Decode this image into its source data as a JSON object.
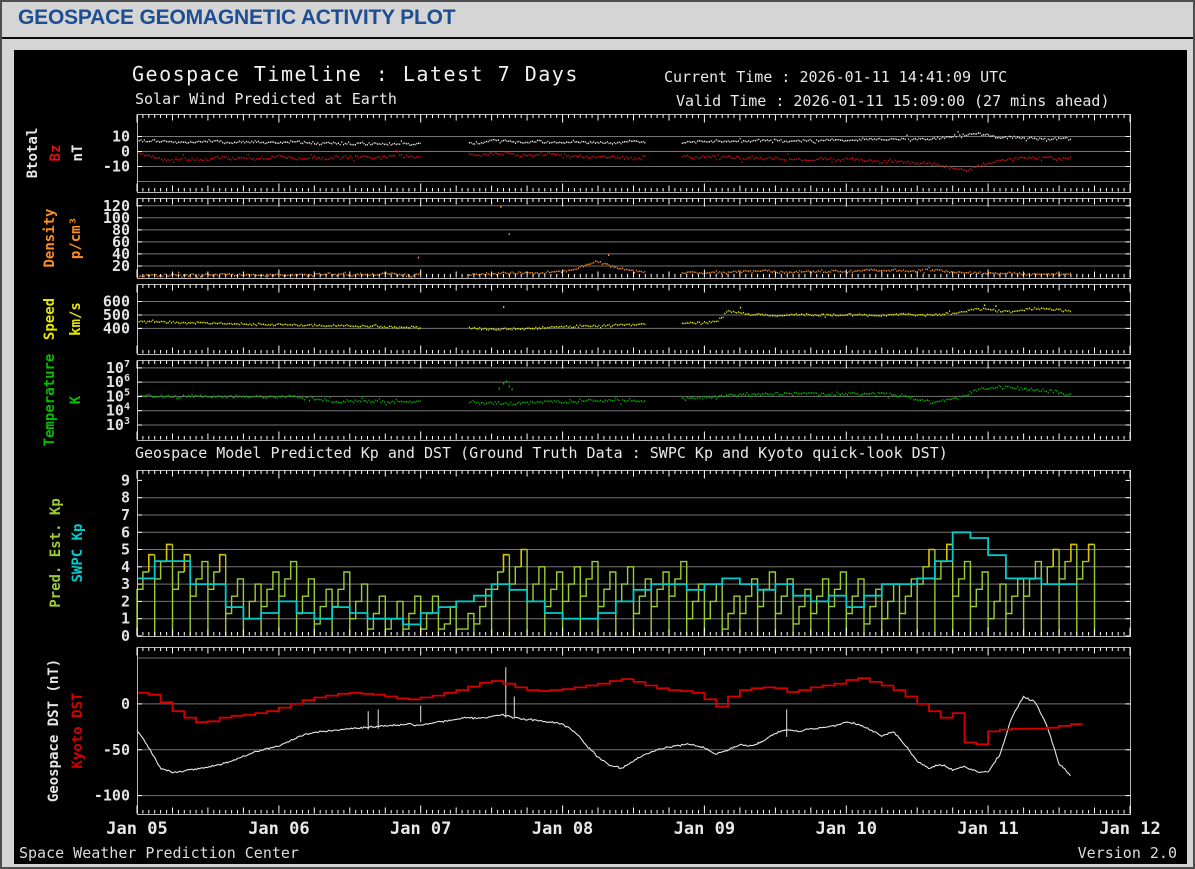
{
  "window": {
    "title": "GEOSPACE GEOMAGNETIC ACTIVITY PLOT",
    "footer_left": "Space Weather Prediction Center",
    "footer_right": "Version 2.0"
  },
  "header": {
    "title": "Geospace Timeline : Latest 7 Days",
    "subtitle": "Solar Wind Predicted at Earth",
    "current_time": "Current Time : 2026-01-11 14:41:09 UTC",
    "valid_time": "Valid Time : 2026-01-11 15:09:00 (27 mins ahead)",
    "kp_section_title": "Geospace Model Predicted Kp and DST (Ground Truth Data : SWPC Kp and Kyoto quick-look DST)"
  },
  "colors": {
    "page_bg": "#d5d5d5",
    "header_blue": "#1e4e92",
    "plot_bg": "#000000",
    "grid": "#757575",
    "frame": "#b8b8b8",
    "tick": "#ffffff",
    "tick_label": "#e2e2e2",
    "btotal": "#e8e8e8",
    "bz": "#dd1111",
    "density": "#ff8f1f",
    "speed": "#e6e600",
    "temperature": "#00c000",
    "pred_kp": "#9acd32",
    "pred_kp_high": "#d9c300",
    "swpc_kp": "#00cccc",
    "geospace_dst": "#e4e4e4",
    "kyoto_dst": "#d40000"
  },
  "chart_data": {
    "type": "line",
    "note": "multi-panel time series, 7 days, x in day-of-January units",
    "x_range_days": [
      5,
      12
    ],
    "x_labels": [
      "Jan 05",
      "Jan 06",
      "Jan 07",
      "Jan 08",
      "Jan 09",
      "Jan 10",
      "Jan 11",
      "Jan 12"
    ],
    "panels": [
      {
        "id": "imf",
        "kind": "scatter",
        "ylabels": [
          {
            "text": "Btotal",
            "color": "#e8e8e8"
          },
          {
            "text": "Bz",
            "color": "#dd1111"
          },
          {
            "text": "nT",
            "color": "#e8e8e8"
          }
        ],
        "ylim": [
          -27,
          25
        ],
        "yticks": [
          10,
          0,
          -10
        ],
        "grid": [
          10,
          0,
          -10,
          -20
        ],
        "series": [
          {
            "name": "Btotal",
            "color": "#e8e8e8",
            "jitter": 1.0,
            "x0": 5,
            "dt_days": 0.08333,
            "values": [
              7,
              7.5,
              7,
              6.5,
              6,
              6.5,
              7,
              6.5,
              6,
              6,
              6.5,
              6,
              6,
              6.5,
              6,
              5.5,
              6,
              5.5,
              5,
              5.5,
              5,
              5,
              5.5,
              5,
              5,
              null,
              null,
              null,
              5.5,
              6,
              7.5,
              7,
              6.5,
              6,
              6.5,
              6,
              6,
              6.5,
              6,
              6,
              5.5,
              6,
              6.5,
              6,
              null,
              null,
              6,
              6.5,
              6.5,
              7,
              7,
              6.5,
              7,
              7.5,
              7,
              7,
              7.5,
              7,
              7.5,
              8,
              7.5,
              8,
              8,
              7.5,
              8,
              8.5,
              8,
              8.5,
              9,
              10,
              11,
              12,
              11,
              9,
              9.5,
              9,
              8.5,
              8,
              8.5,
              8
            ]
          },
          {
            "name": "Bz",
            "color": "#dd1111",
            "jitter": 1.3,
            "x0": 5,
            "dt_days": 0.08333,
            "values": [
              -1,
              -3,
              -5,
              -6,
              -5,
              -6,
              -5,
              -4,
              -5,
              -4,
              -5,
              -4,
              -3,
              -4,
              -5,
              -4,
              -5,
              -4,
              -4,
              -3,
              -4,
              -3,
              -3,
              -4,
              -3,
              null,
              null,
              null,
              -2,
              -3,
              -2,
              -1,
              -2,
              -3,
              -2,
              -2,
              -2,
              -3,
              -4,
              -3,
              -4,
              -4,
              -5,
              -4,
              null,
              null,
              -3,
              -4,
              -4,
              -3,
              -4,
              -5,
              -4,
              -5,
              -4,
              -5,
              -5,
              -6,
              -5,
              -6,
              -5,
              -6,
              -6,
              -7,
              -6,
              -7,
              -8,
              -8,
              -9,
              -11,
              -13,
              -10,
              -8,
              -6,
              -5,
              -4,
              -5,
              -4,
              -5,
              -4
            ]
          }
        ]
      },
      {
        "id": "density",
        "kind": "scatter",
        "ylabels": [
          {
            "text": "Density",
            "color": "#ff8f1f"
          },
          {
            "text": "p/cm³",
            "color": "#ff8f1f"
          }
        ],
        "ylim": [
          0,
          133
        ],
        "yticks": [
          120,
          100,
          80,
          60,
          40,
          20
        ],
        "grid": [
          120,
          100,
          80,
          60,
          40,
          20
        ],
        "series": [
          {
            "name": "Density",
            "color": "#ff8f1f",
            "jitter": 2.2,
            "x0": 5,
            "dt_days": 0.08333,
            "values": [
              4,
              5,
              4,
              6,
              5,
              4,
              5,
              6,
              5,
              4,
              5,
              4,
              5,
              4,
              6,
              5,
              7,
              6,
              5,
              6,
              5,
              7,
              6,
              5,
              6,
              null,
              null,
              null,
              7,
              6,
              7,
              8,
              8,
              9,
              9,
              10,
              10,
              14,
              22,
              28,
              20,
              14,
              12,
              10,
              null,
              null,
              9,
              10,
              8,
              10,
              9,
              11,
              10,
              12,
              10,
              9,
              10,
              11,
              10,
              12,
              10,
              12,
              14,
              12,
              13,
              11,
              12,
              14,
              12,
              10,
              9,
              8,
              8,
              7,
              8,
              6,
              7,
              6,
              6,
              7
            ],
            "outliers": [
              [
                7.56,
                118
              ],
              [
                7.62,
                73
              ],
              [
                8.32,
                38
              ],
              [
                6.98,
                34
              ]
            ]
          }
        ]
      },
      {
        "id": "speed",
        "kind": "scatter",
        "ylabels": [
          {
            "text": "Speed",
            "color": "#e6e600"
          },
          {
            "text": "km/s",
            "color": "#e6e600"
          }
        ],
        "ylim": [
          210,
          730
        ],
        "yticks": [
          600,
          500,
          400
        ],
        "grid": [
          600,
          500,
          400
        ],
        "series": [
          {
            "name": "Speed",
            "color": "#e6e600",
            "jitter": 9,
            "x0": 5,
            "dt_days": 0.08333,
            "values": [
              455,
              452,
              448,
              445,
              442,
              440,
              438,
              436,
              434,
              432,
              430,
              428,
              428,
              426,
              424,
              422,
              420,
              422,
              418,
              416,
              414,
              412,
              410,
              408,
              408,
              null,
              null,
              null,
              400,
              398,
              396,
              394,
              396,
              400,
              405,
              410,
              412,
              415,
              418,
              420,
              424,
              428,
              430,
              432,
              null,
              null,
              436,
              440,
              444,
              446,
              530,
              515,
              505,
              500,
              495,
              498,
              500,
              502,
              498,
              500,
              500,
              502,
              498,
              495,
              500,
              505,
              498,
              502,
              505,
              510,
              530,
              545,
              540,
              530,
              525,
              540,
              550,
              545,
              535,
              530
            ],
            "outliers": [
              [
                7.58,
                560
              ],
              [
                9.25,
                555
              ],
              [
                10.97,
                572
              ],
              [
                11.05,
                565
              ]
            ]
          }
        ]
      },
      {
        "id": "temperature",
        "kind": "scatter",
        "scale": "log10",
        "ylabels": [
          {
            "text": "Temperature",
            "color": "#00c000"
          },
          {
            "text": "K",
            "color": "#00c000"
          }
        ],
        "ylim": [
          1.95,
          7.55
        ],
        "yticks": [
          7,
          6,
          5,
          4,
          3
        ],
        "grid": [
          7,
          6,
          5,
          4,
          3
        ],
        "series": [
          {
            "name": "Temperature_log10K",
            "color": "#00c000",
            "jitter": 0.13,
            "x0": 5,
            "dt_days": 0.08333,
            "values": [
              5.0,
              5.05,
              5.0,
              4.95,
              5.0,
              5.05,
              5.0,
              4.95,
              5.0,
              4.95,
              5.0,
              4.95,
              4.95,
              5.0,
              4.9,
              4.85,
              4.7,
              4.6,
              4.65,
              4.7,
              4.65,
              4.6,
              4.65,
              4.6,
              4.6,
              null,
              null,
              null,
              4.6,
              4.55,
              4.5,
              4.55,
              4.5,
              4.55,
              4.6,
              4.65,
              4.6,
              4.65,
              4.7,
              4.65,
              4.7,
              4.75,
              4.7,
              4.75,
              null,
              null,
              4.8,
              4.85,
              4.9,
              4.95,
              5.1,
              5.15,
              5.1,
              5.15,
              5.2,
              5.15,
              5.2,
              5.25,
              5.2,
              5.15,
              5.2,
              5.15,
              5.2,
              5.15,
              5.1,
              5.05,
              4.8,
              4.6,
              4.65,
              4.8,
              5.1,
              5.5,
              5.6,
              5.65,
              5.6,
              5.5,
              5.45,
              5.4,
              5.3,
              5.2
            ],
            "outliers": [
              [
                7.55,
                5.55
              ],
              [
                7.58,
                5.9
              ],
              [
                7.6,
                6.05
              ],
              [
                7.62,
                5.7
              ],
              [
                7.64,
                5.5
              ]
            ]
          }
        ]
      },
      {
        "id": "kp",
        "kind": "kp",
        "ylabels": [
          {
            "text": "Pred. Est. Kp",
            "color": "#9acd32"
          },
          {
            "text": "SWPC Kp",
            "color": "#00cccc"
          }
        ],
        "ylim": [
          0,
          9.6
        ],
        "yticks": [
          9,
          8,
          7,
          6,
          5,
          4,
          3,
          2,
          1,
          0
        ],
        "grid": [
          8,
          7,
          6,
          5,
          4,
          3,
          2,
          1
        ],
        "pred": {
          "name": "Pred. Est. Kp",
          "color": "#9acd32",
          "high_color": "#d9c300",
          "high_threshold": 4.6,
          "x0": 5,
          "dt_days": 0.125,
          "peaks": [
            4.7,
            5.3,
            4.7,
            4.3,
            4.7,
            3.3,
            3.0,
            3.7,
            4.3,
            3.3,
            2.7,
            3.7,
            3.0,
            2.3,
            2.0,
            2.3,
            2.3,
            1.7,
            1.3,
            2.7,
            4.7,
            5.0,
            4.0,
            3.7,
            4.0,
            4.3,
            3.7,
            4.0,
            3.3,
            3.7,
            4.3,
            3.0,
            3.0,
            2.3,
            3.3,
            3.7,
            3.3,
            2.7,
            3.3,
            3.7,
            3.3,
            2.7,
            3.0,
            3.3,
            5.0,
            5.3,
            4.3,
            3.7,
            3.0,
            3.3,
            4.3,
            5.0,
            5.3,
            5.3
          ]
        },
        "swpc": {
          "name": "SWPC Kp",
          "color": "#00cccc",
          "x0": 5,
          "dt_days": 0.125,
          "values": [
            3.33,
            4.33,
            4.33,
            3,
            3,
            1.67,
            1,
            1.33,
            2,
            1.33,
            1,
            1.67,
            1.33,
            1,
            1,
            0.67,
            1.33,
            1.67,
            2,
            2.33,
            3,
            2.67,
            2,
            1.33,
            1,
            1,
            1.33,
            2,
            2.67,
            3,
            3,
            2.67,
            3,
            3.33,
            3,
            2.67,
            3,
            2.33,
            2,
            2.33,
            1.67,
            2.33,
            3,
            3,
            3.33,
            4.33,
            6,
            5.67,
            4.67,
            3.33,
            3.33,
            3,
            3
          ]
        }
      },
      {
        "id": "dst",
        "kind": "dst",
        "ylabels": [
          {
            "text": "Geospace DST (nT)",
            "color": "#e4e4e4"
          },
          {
            "text": "Kyoto DST",
            "color": "#d40000"
          }
        ],
        "ylim": [
          -120,
          62
        ],
        "yticks": [
          0,
          -50,
          -100
        ],
        "grid": [
          50,
          0,
          -50,
          -100
        ],
        "geospace": {
          "name": "Geospace DST",
          "color": "#e4e4e4",
          "x0": 5,
          "dt_days": 0.08333,
          "jitter": 1.2,
          "values": [
            -28,
            -48,
            -70,
            -75,
            -73,
            -71,
            -69,
            -66,
            -62,
            -57,
            -52,
            -49,
            -46,
            -40,
            -34,
            -31,
            -30,
            -28,
            -27,
            -26,
            -25,
            -24,
            -23,
            -22,
            -24,
            -21,
            -19,
            -17,
            -15,
            -16,
            -14,
            -12,
            -15,
            -17,
            -18,
            -20,
            -22,
            -30,
            -45,
            -58,
            -67,
            -70,
            -62,
            -55,
            -50,
            -47,
            -45,
            -44,
            -48,
            -55,
            -50,
            -44,
            -46,
            -40,
            -32,
            -28,
            -30,
            -27,
            -26,
            -24,
            -20,
            -22,
            -28,
            -35,
            -30,
            -45,
            -62,
            -70,
            -66,
            -72,
            -68,
            -74,
            -74,
            -55,
            -15,
            8,
            2,
            -25,
            -65,
            -78
          ],
          "spikes": [
            [
              6.63,
              -28,
              -8
            ],
            [
              6.7,
              -27,
              -6
            ],
            [
              7.0,
              -20,
              -2
            ],
            [
              7.6,
              -15,
              40
            ],
            [
              7.66,
              -14,
              8
            ],
            [
              9.58,
              -36,
              -6
            ]
          ]
        },
        "kyoto": {
          "name": "Kyoto DST",
          "color": "#d40000",
          "x0": 5,
          "dt_days": 0.08333,
          "values": [
            12,
            10,
            2,
            -8,
            -15,
            -20,
            -19,
            -15,
            -13,
            -12,
            -10,
            -8,
            -4,
            0,
            4,
            7,
            9,
            11,
            12,
            11,
            10,
            8,
            6,
            5,
            7,
            9,
            12,
            15,
            19,
            23,
            25,
            22,
            18,
            15,
            14,
            15,
            16,
            18,
            20,
            22,
            25,
            27,
            24,
            20,
            17,
            15,
            14,
            12,
            5,
            -3,
            8,
            15,
            17,
            18,
            17,
            13,
            15,
            18,
            20,
            22,
            26,
            28,
            24,
            20,
            15,
            8,
            0,
            -8,
            -15,
            -10,
            -42,
            -44,
            -30,
            -28,
            -27,
            -27,
            -27,
            -26,
            -24,
            -22
          ]
        }
      }
    ]
  }
}
